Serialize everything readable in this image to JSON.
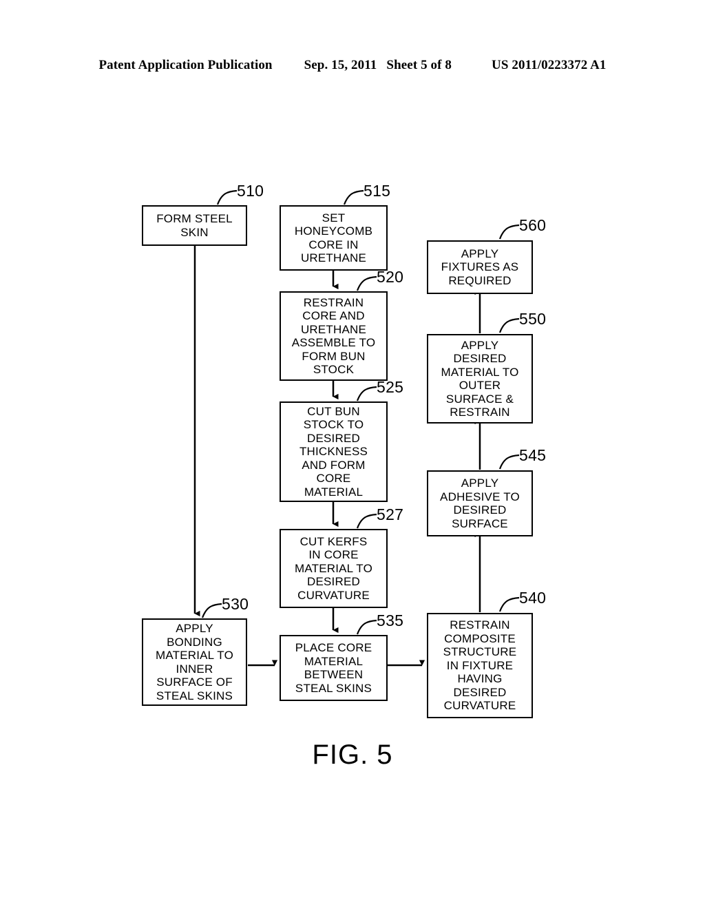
{
  "header": {
    "publication": "Patent Application Publication",
    "date": "Sep. 15, 2011",
    "sheet": "Sheet 5 of 8",
    "number": "US 2011/0223372 A1"
  },
  "figure": {
    "caption": "FIG. 5",
    "line_color": "#000000",
    "boxes": [
      {
        "id": "510",
        "ref": "510",
        "text": "FORM STEEL\nSKIN"
      },
      {
        "id": "515",
        "ref": "515",
        "text": "SET\nHONEYCOMB\nCORE IN\nURETHANE"
      },
      {
        "id": "520",
        "ref": "520",
        "text": "RESTRAIN\nCORE AND\nURETHANE\nASSEMBLE TO\nFORM BUN\nSTOCK"
      },
      {
        "id": "525",
        "ref": "525",
        "text": "CUT BUN\nSTOCK TO\nDESIRED\nTHICKNESS\nAND FORM\nCORE\nMATERIAL"
      },
      {
        "id": "527",
        "ref": "527",
        "text": "CUT KERFS\nIN CORE\nMATERIAL TO\nDESIRED\nCURVATURE"
      },
      {
        "id": "530",
        "ref": "530",
        "text": "APPLY\nBONDING\nMATERIAL TO\nINNER\nSURFACE OF\nSTEAL SKINS"
      },
      {
        "id": "535",
        "ref": "535",
        "text": "PLACE CORE\nMATERIAL\nBETWEEN\nSTEAL SKINS"
      },
      {
        "id": "540",
        "ref": "540",
        "text": "RESTRAIN\nCOMPOSITE\nSTRUCTURE\nIN FIXTURE\nHAVING\nDESIRED\nCURVATURE"
      },
      {
        "id": "545",
        "ref": "545",
        "text": "APPLY\nADHESIVE TO\nDESIRED\nSURFACE"
      },
      {
        "id": "550",
        "ref": "550",
        "text": "APPLY\nDESIRED\nMATERIAL TO\nOUTER\nSURFACE &\nRESTRAIN"
      },
      {
        "id": "560",
        "ref": "560",
        "text": "APPLY\nFIXTURES AS\nREQUIRED"
      }
    ]
  }
}
